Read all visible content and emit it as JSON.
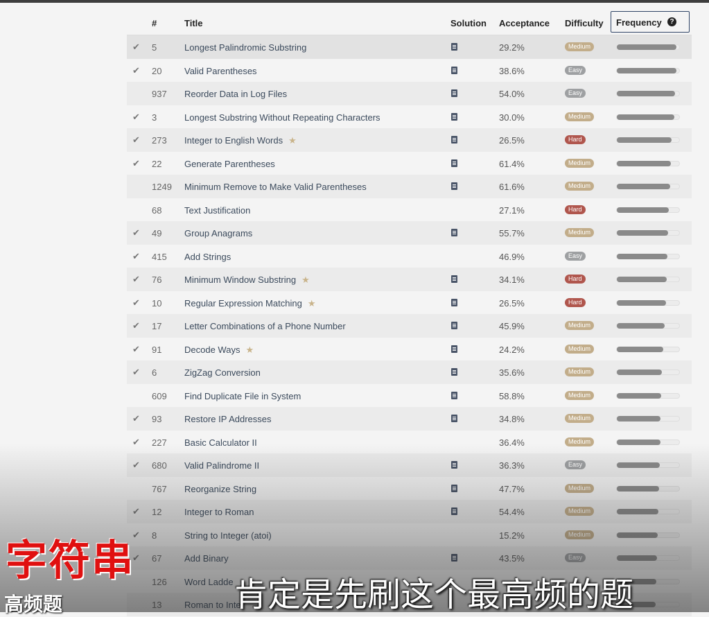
{
  "table": {
    "headers": {
      "num": "#",
      "title": "Title",
      "solution": "Solution",
      "acceptance": "Acceptance",
      "difficulty": "Difficulty",
      "frequency": "Frequency"
    },
    "rows": [
      {
        "solved": true,
        "num": "5",
        "title": "Longest Palindromic Substring",
        "star": false,
        "solution": true,
        "acceptance": "29.2%",
        "difficulty": "Medium",
        "freq": 0.94
      },
      {
        "solved": true,
        "num": "20",
        "title": "Valid Parentheses",
        "star": false,
        "solution": true,
        "acceptance": "38.6%",
        "difficulty": "Easy",
        "freq": 0.93
      },
      {
        "solved": false,
        "num": "937",
        "title": "Reorder Data in Log Files",
        "star": false,
        "solution": true,
        "acceptance": "54.0%",
        "difficulty": "Easy",
        "freq": 0.91
      },
      {
        "solved": true,
        "num": "3",
        "title": "Longest Substring Without Repeating Characters",
        "star": false,
        "solution": true,
        "acceptance": "30.0%",
        "difficulty": "Medium",
        "freq": 0.9
      },
      {
        "solved": true,
        "num": "273",
        "title": "Integer to English Words",
        "star": true,
        "solution": true,
        "acceptance": "26.5%",
        "difficulty": "Hard",
        "freq": 0.86
      },
      {
        "solved": true,
        "num": "22",
        "title": "Generate Parentheses",
        "star": false,
        "solution": true,
        "acceptance": "61.4%",
        "difficulty": "Medium",
        "freq": 0.85
      },
      {
        "solved": false,
        "num": "1249",
        "title": "Minimum Remove to Make Valid Parentheses",
        "star": false,
        "solution": true,
        "acceptance": "61.6%",
        "difficulty": "Medium",
        "freq": 0.84
      },
      {
        "solved": false,
        "num": "68",
        "title": "Text Justification",
        "star": false,
        "solution": false,
        "acceptance": "27.1%",
        "difficulty": "Hard",
        "freq": 0.82
      },
      {
        "solved": true,
        "num": "49",
        "title": "Group Anagrams",
        "star": false,
        "solution": true,
        "acceptance": "55.7%",
        "difficulty": "Medium",
        "freq": 0.8
      },
      {
        "solved": true,
        "num": "415",
        "title": "Add Strings",
        "star": false,
        "solution": false,
        "acceptance": "46.9%",
        "difficulty": "Easy",
        "freq": 0.79
      },
      {
        "solved": true,
        "num": "76",
        "title": "Minimum Window Substring",
        "star": true,
        "solution": true,
        "acceptance": "34.1%",
        "difficulty": "Hard",
        "freq": 0.78
      },
      {
        "solved": true,
        "num": "10",
        "title": "Regular Expression Matching",
        "star": true,
        "solution": true,
        "acceptance": "26.5%",
        "difficulty": "Hard",
        "freq": 0.77
      },
      {
        "solved": true,
        "num": "17",
        "title": "Letter Combinations of a Phone Number",
        "star": false,
        "solution": true,
        "acceptance": "45.9%",
        "difficulty": "Medium",
        "freq": 0.75
      },
      {
        "solved": true,
        "num": "91",
        "title": "Decode Ways",
        "star": true,
        "solution": true,
        "acceptance": "24.2%",
        "difficulty": "Medium",
        "freq": 0.73
      },
      {
        "solved": true,
        "num": "6",
        "title": "ZigZag Conversion",
        "star": false,
        "solution": true,
        "acceptance": "35.6%",
        "difficulty": "Medium",
        "freq": 0.71
      },
      {
        "solved": false,
        "num": "609",
        "title": "Find Duplicate File in System",
        "star": false,
        "solution": true,
        "acceptance": "58.8%",
        "difficulty": "Medium",
        "freq": 0.7
      },
      {
        "solved": true,
        "num": "93",
        "title": "Restore IP Addresses",
        "star": false,
        "solution": true,
        "acceptance": "34.8%",
        "difficulty": "Medium",
        "freq": 0.69
      },
      {
        "solved": true,
        "num": "227",
        "title": "Basic Calculator II",
        "star": false,
        "solution": false,
        "acceptance": "36.4%",
        "difficulty": "Medium",
        "freq": 0.68
      },
      {
        "solved": true,
        "num": "680",
        "title": "Valid Palindrome II",
        "star": false,
        "solution": true,
        "acceptance": "36.3%",
        "difficulty": "Easy",
        "freq": 0.67
      },
      {
        "solved": false,
        "num": "767",
        "title": "Reorganize String",
        "star": false,
        "solution": true,
        "acceptance": "47.7%",
        "difficulty": "Medium",
        "freq": 0.66
      },
      {
        "solved": true,
        "num": "12",
        "title": "Integer to Roman",
        "star": false,
        "solution": true,
        "acceptance": "54.4%",
        "difficulty": "Medium",
        "freq": 0.65
      },
      {
        "solved": true,
        "num": "8",
        "title": "String to Integer (atoi)",
        "star": false,
        "solution": false,
        "acceptance": "15.2%",
        "difficulty": "Medium",
        "freq": 0.64
      },
      {
        "solved": true,
        "num": "67",
        "title": "Add Binary",
        "star": false,
        "solution": true,
        "acceptance": "43.5%",
        "difficulty": "Easy",
        "freq": 0.63
      },
      {
        "solved": false,
        "num": "126",
        "title": "Word Ladde",
        "star": false,
        "solution": false,
        "acceptance": "",
        "difficulty": "",
        "freq": 0.62
      },
      {
        "solved": false,
        "num": "13",
        "title": "Roman to Inte",
        "star": false,
        "solution": false,
        "acceptance": "",
        "difficulty": "",
        "freq": 0.61
      }
    ]
  },
  "captions": {
    "title": "字符串",
    "subtitle": "高频题",
    "main": "肯定是先刷这个最高频的题"
  },
  "colors": {
    "easy": "#9ea0a2",
    "medium": "#c2ad8a",
    "hard": "#b0564d",
    "caption_red": "#e01010"
  }
}
